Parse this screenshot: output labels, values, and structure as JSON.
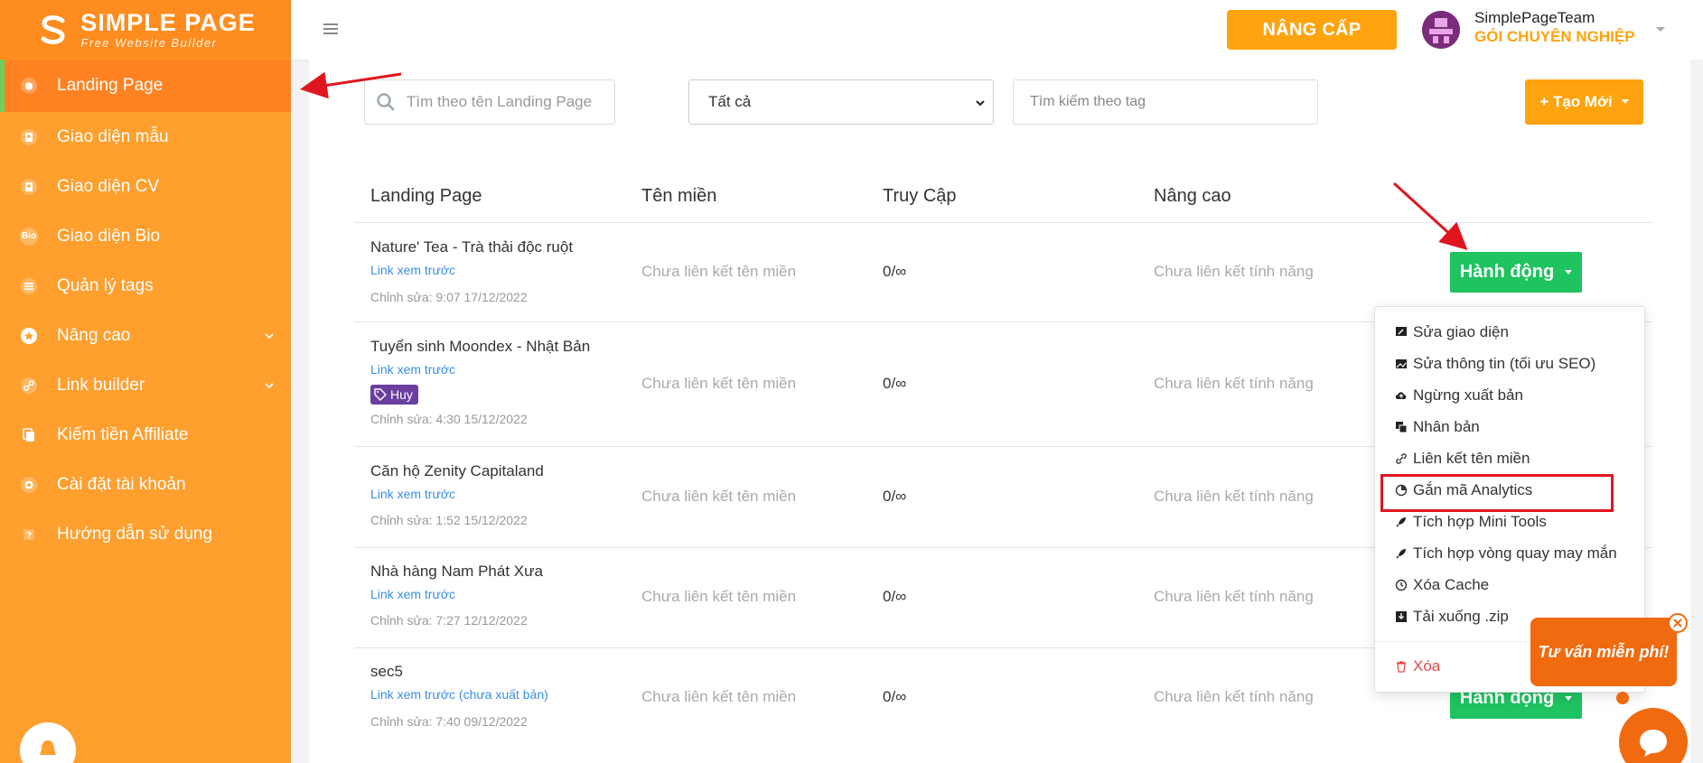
{
  "brand": {
    "title": "SIMPLE PAGE",
    "subtitle": "Free Website Builder",
    "color": "#ff9f2e"
  },
  "sidebar": {
    "items": [
      {
        "label": "Landing Page",
        "icon": "box-icon",
        "active": true
      },
      {
        "label": "Giao diện mẫu",
        "icon": "template-icon"
      },
      {
        "label": "Giao diện CV",
        "icon": "id-card-icon"
      },
      {
        "label": "Giao diện Bio",
        "icon": "bio-icon",
        "icon_text": "Bio"
      },
      {
        "label": "Quản lý tags",
        "icon": "list-icon"
      },
      {
        "label": "Nâng cao",
        "icon": "star-circle-icon",
        "expandable": true
      },
      {
        "label": "Link builder",
        "icon": "link-icon",
        "expandable": true
      },
      {
        "label": "Kiếm tiền Affiliate",
        "icon": "copy-icon"
      },
      {
        "label": "Cài đặt tài khoản",
        "icon": "gear-icon"
      },
      {
        "label": "Hướng dẫn sử dụng",
        "icon": "help-icon"
      }
    ]
  },
  "header": {
    "upgrade_label": "NÂNG CẤP",
    "user_name": "SimplePageTeam",
    "user_plan": "GÓI CHUYÊN NGHIỆP"
  },
  "filters": {
    "search_placeholder": "Tìm theo tên Landing Page",
    "select_value": "Tất cả",
    "tag_placeholder": "Tìm kiếm theo tag",
    "new_label": "+ Tạo Mới"
  },
  "table": {
    "headers": [
      "Landing Page",
      "Tên miền",
      "Truy Cập",
      "Nâng cao"
    ],
    "rows": [
      {
        "name": "Nature' Tea - Trà thải độc ruột",
        "link": "Link xem trước",
        "edited": "Chỉnh sửa: 9:07 17/12/2022",
        "domain": "Chưa liên kết tên miền",
        "visits": "0/∞",
        "advanced": "Chưa liên kết tính năng",
        "action": "Hành động"
      },
      {
        "name": "Tuyển sinh Moondex - Nhật Bản",
        "link": "Link xem trước",
        "tag": "Huy",
        "edited": "Chỉnh sửa: 4:30 15/12/2022",
        "domain": "Chưa liên kết tên miền",
        "visits": "0/∞",
        "advanced": "Chưa liên kết tính năng"
      },
      {
        "name": "Căn hộ Zenity Capitaland",
        "link": "Link xem trước",
        "edited": "Chỉnh sửa: 1:52 15/12/2022",
        "domain": "Chưa liên kết tên miền",
        "visits": "0/∞",
        "advanced": "Chưa liên kết tính năng"
      },
      {
        "name": "Nhà hàng Nam Phát Xưa",
        "link": "Link xem trước",
        "edited": "Chỉnh sửa: 7:27 12/12/2022",
        "domain": "Chưa liên kết tên miền",
        "visits": "0/∞",
        "advanced": "Chưa liên kết tính năng"
      },
      {
        "name": "sec5",
        "link": "Link xem trước (chưa xuất bản)",
        "edited": "Chỉnh sửa: 7:40 09/12/2022",
        "domain": "Chưa liên kết tên miền",
        "visits": "0/∞",
        "advanced": "Chưa liên kết tính năng",
        "action": "Hành động"
      }
    ]
  },
  "action_menu": {
    "items": [
      {
        "label": "Sửa giao diện",
        "icon": "edit-layout-icon"
      },
      {
        "label": "Sửa thông tin (tối ưu SEO)",
        "icon": "image-edit-icon"
      },
      {
        "label": "Ngừng xuất bản",
        "icon": "cloud-upload-icon"
      },
      {
        "label": "Nhân bản",
        "icon": "clone-icon"
      },
      {
        "label": "Liên kết tên miền",
        "icon": "link-icon"
      },
      {
        "label": "Gắn mã Analytics",
        "icon": "pie-chart-icon",
        "highlighted": true
      },
      {
        "label": "Tích hợp Mini Tools",
        "icon": "rocket-icon"
      },
      {
        "label": "Tích hợp vòng quay may mắn",
        "icon": "rocket-icon"
      },
      {
        "label": "Xóa Cache",
        "icon": "history-icon"
      },
      {
        "label": "Tải xuống .zip",
        "icon": "download-icon"
      },
      {
        "label": "Xóa",
        "icon": "trash-icon",
        "danger": true
      }
    ]
  },
  "chat": {
    "label": "Tư vấn miễn phí!"
  },
  "colors": {
    "orange": "#ffa30f",
    "green": "#1fc360",
    "link": "#3a8ee6",
    "danger": "#e54b4b",
    "tag": "#6a3fa0"
  }
}
